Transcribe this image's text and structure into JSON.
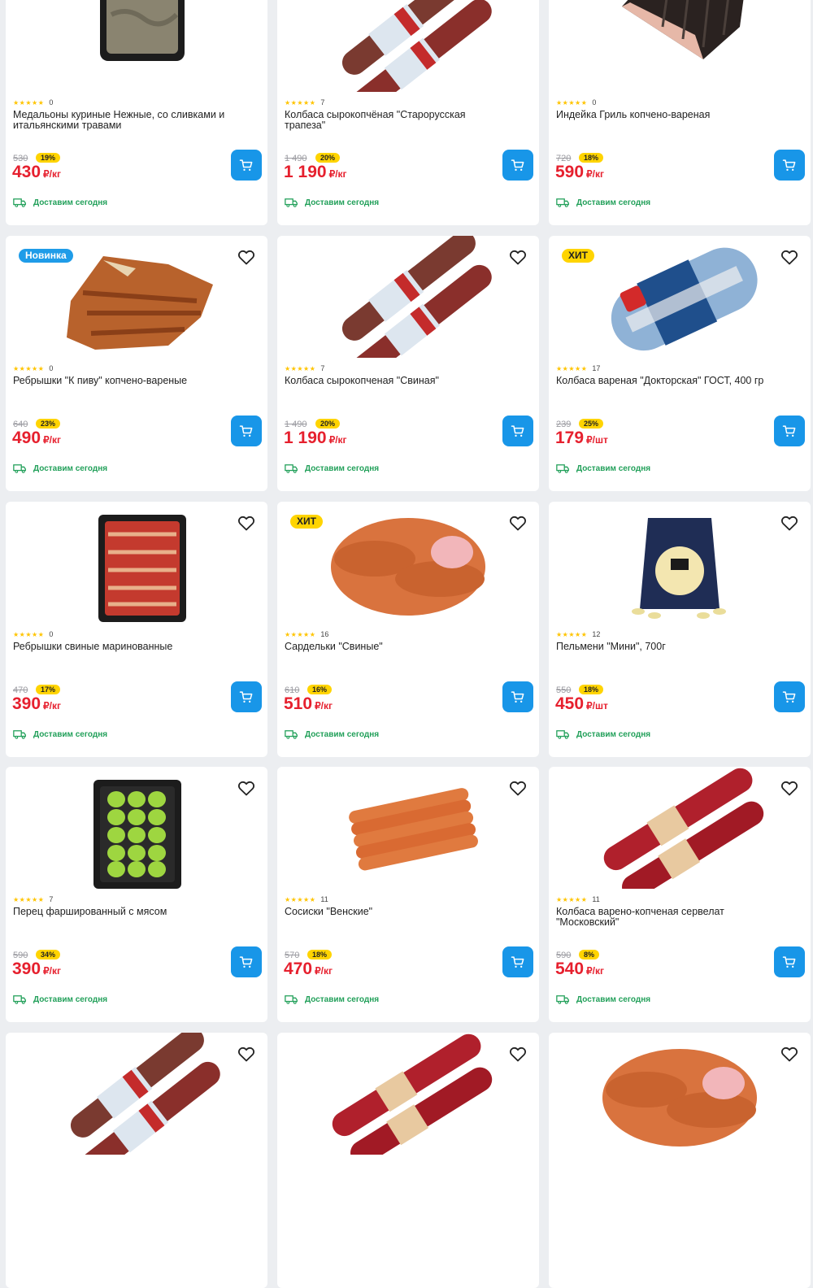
{
  "currency_badge_colors": {
    "new": "#1f9ce8",
    "hit": "#ffd400",
    "price": "#e6202e",
    "cart": "#1896e8",
    "delivery": "#22a05a"
  },
  "products": [
    {
      "badge": "",
      "badge_type": "",
      "rating_count": "0",
      "title": "Медальоны куриные Нежные, со сливками и итальянскими травами",
      "old_price": "530",
      "discount": "19%",
      "price": "430",
      "unit": "₽/кг",
      "delivery": "Доставим сегодня",
      "image": "chicken-medallions-tray",
      "favorite": false
    },
    {
      "badge": "",
      "badge_type": "",
      "rating_count": "7",
      "title": "Колбаса сырокопчёная \"Старорусская трапеза\"",
      "old_price": "1 490",
      "discount": "20%",
      "price": "1 190",
      "unit": "₽/кг",
      "delivery": "Доставим сегодня",
      "image": "dry-sausage",
      "favorite": false
    },
    {
      "badge": "",
      "badge_type": "",
      "rating_count": "0",
      "title": "Индейка Гриль копчено-вареная",
      "old_price": "720",
      "discount": "18%",
      "price": "590",
      "unit": "₽/кг",
      "delivery": "Доставим сегодня",
      "image": "turkey-grill",
      "favorite": false
    },
    {
      "badge": "Новинка",
      "badge_type": "new",
      "rating_count": "0",
      "title": "Ребрышки \"К пиву\" копчено-вареные",
      "old_price": "640",
      "discount": "23%",
      "price": "490",
      "unit": "₽/кг",
      "delivery": "Доставим сегодня",
      "image": "smoked-ribs",
      "favorite": true
    },
    {
      "badge": "",
      "badge_type": "",
      "rating_count": "7",
      "title": "Колбаса сырокопченая \"Свиная\"",
      "old_price": "1 490",
      "discount": "20%",
      "price": "1 190",
      "unit": "₽/кг",
      "delivery": "Доставим сегодня",
      "image": "dry-sausage",
      "favorite": true
    },
    {
      "badge": "ХИТ",
      "badge_type": "hit",
      "rating_count": "17",
      "title": "Колбаса вареная \"Докторская\" ГОСТ, 400 гр",
      "old_price": "239",
      "discount": "25%",
      "price": "179",
      "unit": "₽/шт",
      "delivery": "Доставим сегодня",
      "image": "boiled-sausage",
      "favorite": true
    },
    {
      "badge": "",
      "badge_type": "",
      "rating_count": "0",
      "title": "Ребрышки свиные маринованные",
      "old_price": "470",
      "discount": "17%",
      "price": "390",
      "unit": "₽/кг",
      "delivery": "Доставим сегодня",
      "image": "marinated-ribs-tray",
      "favorite": true
    },
    {
      "badge": "ХИТ",
      "badge_type": "hit",
      "rating_count": "16",
      "title": "Сардельки \"Свиные\"",
      "old_price": "610",
      "discount": "16%",
      "price": "510",
      "unit": "₽/кг",
      "delivery": "Доставим сегодня",
      "image": "sardelki",
      "favorite": true
    },
    {
      "badge": "",
      "badge_type": "",
      "rating_count": "12",
      "title": "Пельмени \"Мини\", 700г",
      "old_price": "550",
      "discount": "18%",
      "price": "450",
      "unit": "₽/шт",
      "delivery": "Доставим сегодня",
      "image": "dumplings-bag",
      "favorite": true
    },
    {
      "badge": "",
      "badge_type": "",
      "rating_count": "7",
      "title": "Перец фаршированный с мясом",
      "old_price": "590",
      "discount": "34%",
      "price": "390",
      "unit": "₽/кг",
      "delivery": "Доставим сегодня",
      "image": "stuffed-peppers-tray",
      "favorite": true
    },
    {
      "badge": "",
      "badge_type": "",
      "rating_count": "11",
      "title": "Сосиски \"Венские\"",
      "old_price": "570",
      "discount": "18%",
      "price": "470",
      "unit": "₽/кг",
      "delivery": "Доставим сегодня",
      "image": "sausages-vienna",
      "favorite": true
    },
    {
      "badge": "",
      "badge_type": "",
      "rating_count": "11",
      "title": "Колбаса варено-копченая сервелат \"Московский\"",
      "old_price": "590",
      "discount": "8%",
      "price": "540",
      "unit": "₽/кг",
      "delivery": "Доставим сегодня",
      "image": "servelat",
      "favorite": true
    },
    {
      "badge": "",
      "badge_type": "",
      "rating_count": "",
      "title": "",
      "old_price": "",
      "discount": "",
      "price": "",
      "unit": "",
      "delivery": "",
      "image": "dry-sausage",
      "favorite": true
    },
    {
      "badge": "",
      "badge_type": "",
      "rating_count": "",
      "title": "",
      "old_price": "",
      "discount": "",
      "price": "",
      "unit": "",
      "delivery": "",
      "image": "servelat",
      "favorite": true
    },
    {
      "badge": "",
      "badge_type": "",
      "rating_count": "",
      "title": "",
      "old_price": "",
      "discount": "",
      "price": "",
      "unit": "",
      "delivery": "",
      "image": "sardelki",
      "favorite": true
    }
  ]
}
